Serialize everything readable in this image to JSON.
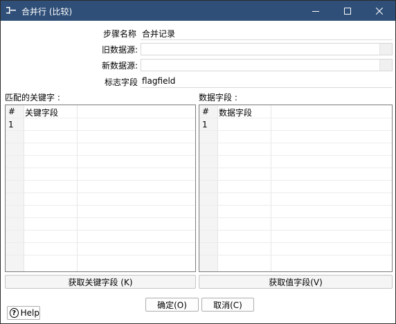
{
  "window": {
    "title": "合并行 (比较)"
  },
  "form": {
    "step_name_label": "步骤名称",
    "step_name_value": "合并记录",
    "old_source_label": "旧数据源:",
    "old_source_value": "",
    "new_source_label": "新数据源:",
    "new_source_value": "",
    "flag_field_label": "标志字段",
    "flag_field_value": "flagfield"
  },
  "keys_table": {
    "section_label": "匹配的关键字 :",
    "col_num": "#",
    "col_field": "关键字段",
    "rows": [
      "1"
    ]
  },
  "values_table": {
    "section_label": "数据字段 :",
    "col_num": "#",
    "col_field": "数据字段",
    "rows": [
      "1"
    ]
  },
  "buttons": {
    "get_keys": "获取关键字段 (K)",
    "get_values": "获取值字段(V)",
    "ok": "确定(O)",
    "cancel": "取消(C)",
    "help": "Help"
  }
}
